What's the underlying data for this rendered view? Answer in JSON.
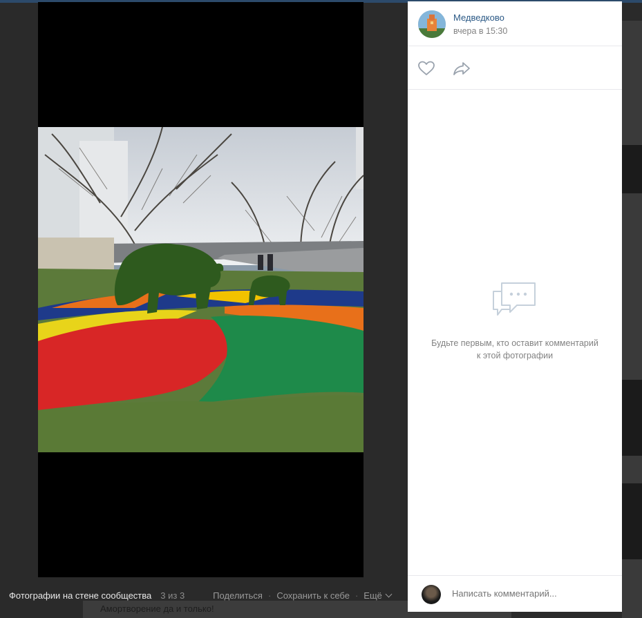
{
  "post": {
    "author": "Медведково",
    "date": "вчера в 15:30"
  },
  "actions": {
    "like_icon": "heart-icon",
    "share_icon": "share-arrow-icon"
  },
  "comments": {
    "empty_message": "Будьте первым, кто оставит комментарий к этой фотографии",
    "placeholder": "Написать комментарий..."
  },
  "bottom_bar": {
    "album_title": "Фотографии на стене сообщества",
    "counter": "3 из 3",
    "share_label": "Поделиться",
    "save_label": "Сохранить к себе",
    "more_label": "Ещё"
  },
  "background": {
    "snippet": "Амортворениe да и только!"
  },
  "colors": {
    "link": "#2a5885",
    "muted": "#828282",
    "icon": "#99a2ad"
  }
}
